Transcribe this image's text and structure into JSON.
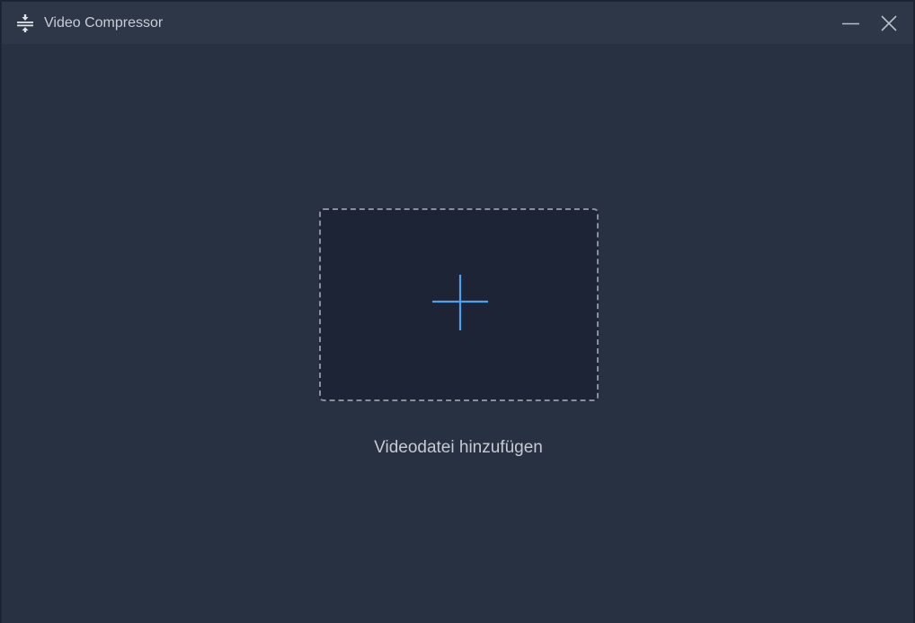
{
  "window": {
    "title": "Video Compressor",
    "app_icon": "compress-icon",
    "controls": {
      "minimize_icon": "minimize-icon",
      "close_icon": "close-icon"
    }
  },
  "main": {
    "drop_zone": {
      "icon": "plus-icon",
      "label": "Videodatei hinzufügen"
    }
  },
  "colors": {
    "background": "#283142",
    "titlebar": "#2e3748",
    "drop_zone_fill": "#1d2435",
    "drop_zone_border": "#8a909b",
    "accent": "#4aa3f0",
    "text": "#c6cad3"
  }
}
